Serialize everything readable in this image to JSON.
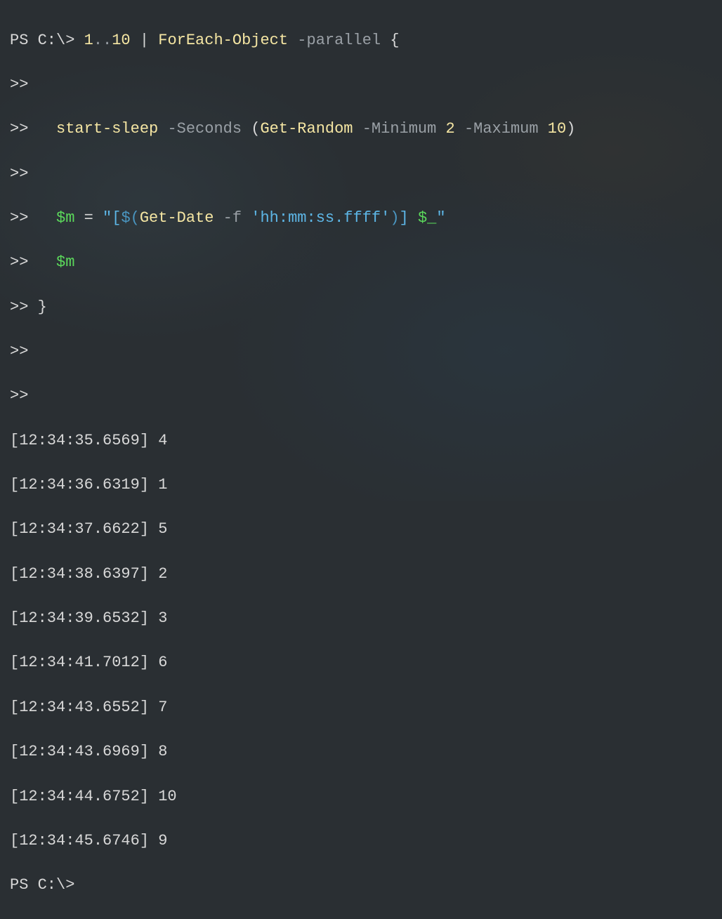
{
  "prompt": "PS C:\\> ",
  "continuation": ">>",
  "script": {
    "range_start": "1",
    "range_end": "10",
    "dots": "..",
    "pipe": " | ",
    "foreach": "ForEach-Object",
    "parallel_param": " -parallel ",
    "open_brace": "{",
    "close_brace": "}",
    "sleep_cmd": "start-sleep",
    "seconds_param": " -Seconds ",
    "open_paren": "(",
    "close_paren": ")",
    "getrandom": "Get-Random",
    "min_param": " -Minimum ",
    "min_val": "2",
    "max_param": " -Maximum ",
    "max_val": "10",
    "var_m": "$m",
    "equals": " = ",
    "str_open": "\"[",
    "subexpr_open": "$(",
    "getdate": "Get-Date",
    "f_param": " -f ",
    "fmt": "'hh:mm:ss.ffff'",
    "subexpr_close": ")",
    "str_mid": "] ",
    "var_item": "$_",
    "str_close": "\""
  },
  "output": [
    "[12:34:35.6569] 4",
    "[12:34:36.6319] 1",
    "[12:34:37.6622] 5",
    "[12:34:38.6397] 2",
    "[12:34:39.6532] 3",
    "[12:34:41.7012] 6",
    "[12:34:43.6552] 7",
    "[12:34:43.6969] 8",
    "[12:34:44.6752] 10",
    "[12:34:45.6746] 9"
  ],
  "final_prompt": "PS C:\\>"
}
